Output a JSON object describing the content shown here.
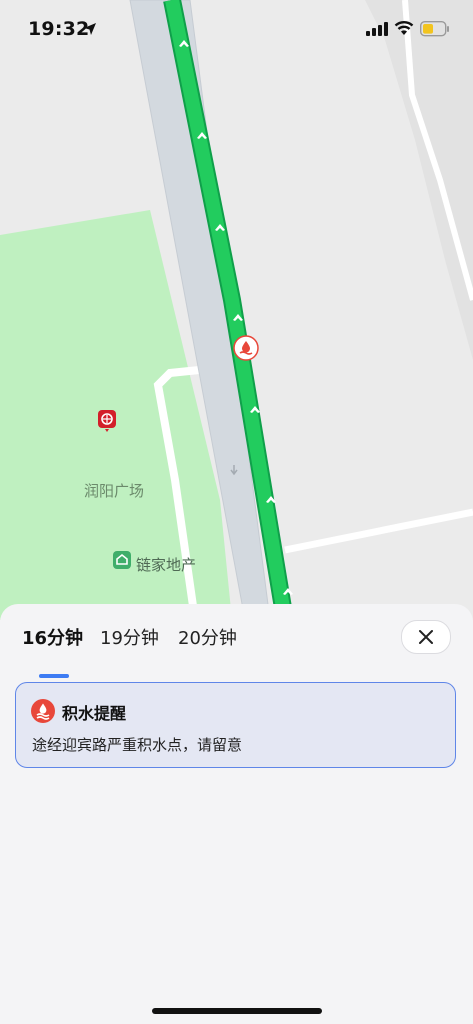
{
  "status_bar": {
    "time": "19:32",
    "icons": [
      "location-arrow-icon",
      "cellular-signal-icon",
      "wifi-icon",
      "battery-icon"
    ],
    "battery_color": "#f2c41f"
  },
  "map": {
    "labels": {
      "plaza": "润阳广场",
      "real_estate": "链家地产"
    },
    "colors": {
      "background": "#ebebeb",
      "park": "#bff0c0",
      "route": "#1ec75a",
      "road": "#d3d9df",
      "water_alert_marker": "#e8473a",
      "unicom_marker": "#d31f2a",
      "realestate_marker": "#3fae6a"
    }
  },
  "route_sheet": {
    "tabs": [
      {
        "label": "16分钟",
        "active": true
      },
      {
        "label": "19分钟",
        "active": false
      },
      {
        "label": "20分钟",
        "active": false
      }
    ],
    "close_icon": "close-icon",
    "accent_color": "#3d7bf3",
    "alert": {
      "icon": "water-logging-icon",
      "title": "积水提醒",
      "message": "途经迎宾路严重积水点，请留意"
    }
  }
}
